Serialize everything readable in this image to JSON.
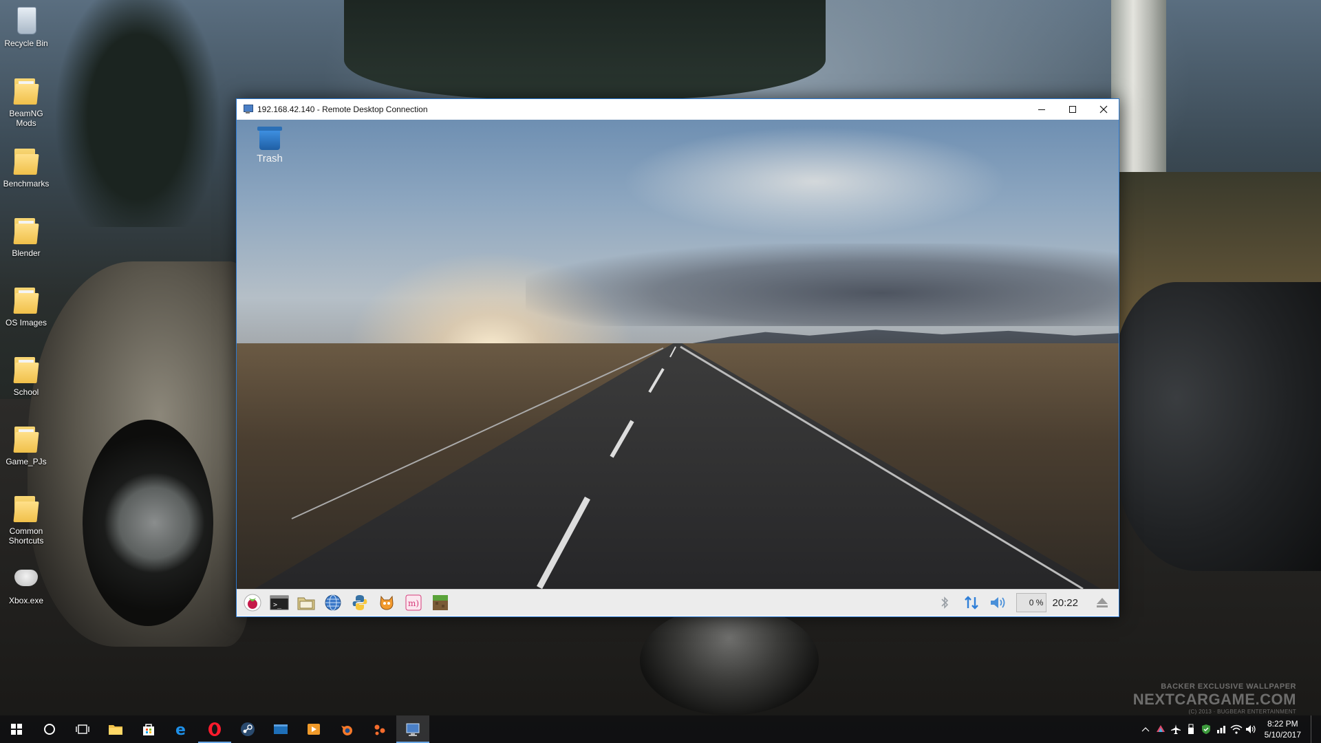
{
  "host_desktop": {
    "icons": [
      {
        "label": "Recycle Bin",
        "icon": "recycle-bin-icon"
      },
      {
        "label": "BeamNG Mods",
        "icon": "folder-icon"
      },
      {
        "label": "Benchmarks",
        "icon": "folder-icon"
      },
      {
        "label": "Blender",
        "icon": "folder-icon"
      },
      {
        "label": "OS Images",
        "icon": "folder-icon"
      },
      {
        "label": "School",
        "icon": "folder-icon"
      },
      {
        "label": "Game_PJs",
        "icon": "folder-icon"
      },
      {
        "label": "Common Shortcuts",
        "icon": "folder-icon"
      },
      {
        "label": "Xbox.exe",
        "icon": "xbox-controller-icon"
      }
    ],
    "watermark": {
      "line1": "BACKER EXCLUSIVE WALLPAPER",
      "line2": "NEXTCARGAME.COM",
      "line3": "(C) 2013 · BUGBEAR ENTERTAINMENT"
    }
  },
  "rdp_window": {
    "title": "192.168.42.140 - Remote Desktop Connection",
    "controls": {
      "minimize": "minimize",
      "maximize": "maximize",
      "close": "close"
    }
  },
  "remote_desktop": {
    "icons": [
      {
        "label": "Trash",
        "icon": "trash-icon"
      }
    ],
    "panel": {
      "launchers": [
        {
          "name": "raspberry-menu-icon"
        },
        {
          "name": "terminal-icon"
        },
        {
          "name": "file-manager-icon"
        },
        {
          "name": "web-browser-icon"
        },
        {
          "name": "python-icon"
        },
        {
          "name": "scratch-icon"
        },
        {
          "name": "mathematica-icon"
        },
        {
          "name": "minecraft-icon"
        }
      ],
      "tray": {
        "bluetooth": "bluetooth-icon",
        "network": "network-arrows-icon",
        "volume": "volume-icon",
        "cpu_value": "0",
        "cpu_unit": "%",
        "clock": "20:22",
        "eject": "eject-icon"
      }
    }
  },
  "windows_taskbar": {
    "buttons": [
      {
        "name": "start-button"
      },
      {
        "name": "cortana-button"
      },
      {
        "name": "task-view-button"
      },
      {
        "name": "file-explorer-button"
      },
      {
        "name": "store-button"
      },
      {
        "name": "edge-button"
      },
      {
        "name": "opera-button"
      },
      {
        "name": "steam-button"
      },
      {
        "name": "app-button"
      },
      {
        "name": "media-player-button"
      },
      {
        "name": "blender-button"
      },
      {
        "name": "origin-button"
      },
      {
        "name": "remote-desktop-button"
      }
    ],
    "clock": {
      "time": "8:22 PM",
      "date": "5/10/2017"
    },
    "tray_icons": [
      "chevron-up-icon",
      "colorful-app-icon",
      "airplane-icon",
      "usb-icon",
      "defender-icon",
      "network-icon",
      "wifi-icon",
      "speaker-icon"
    ]
  },
  "colors": {
    "rdp_border": "#2b78d0",
    "taskbar_bg": "#101012",
    "lx_panel_bg": "#ececec",
    "network_accent": "#2f7fd8"
  }
}
